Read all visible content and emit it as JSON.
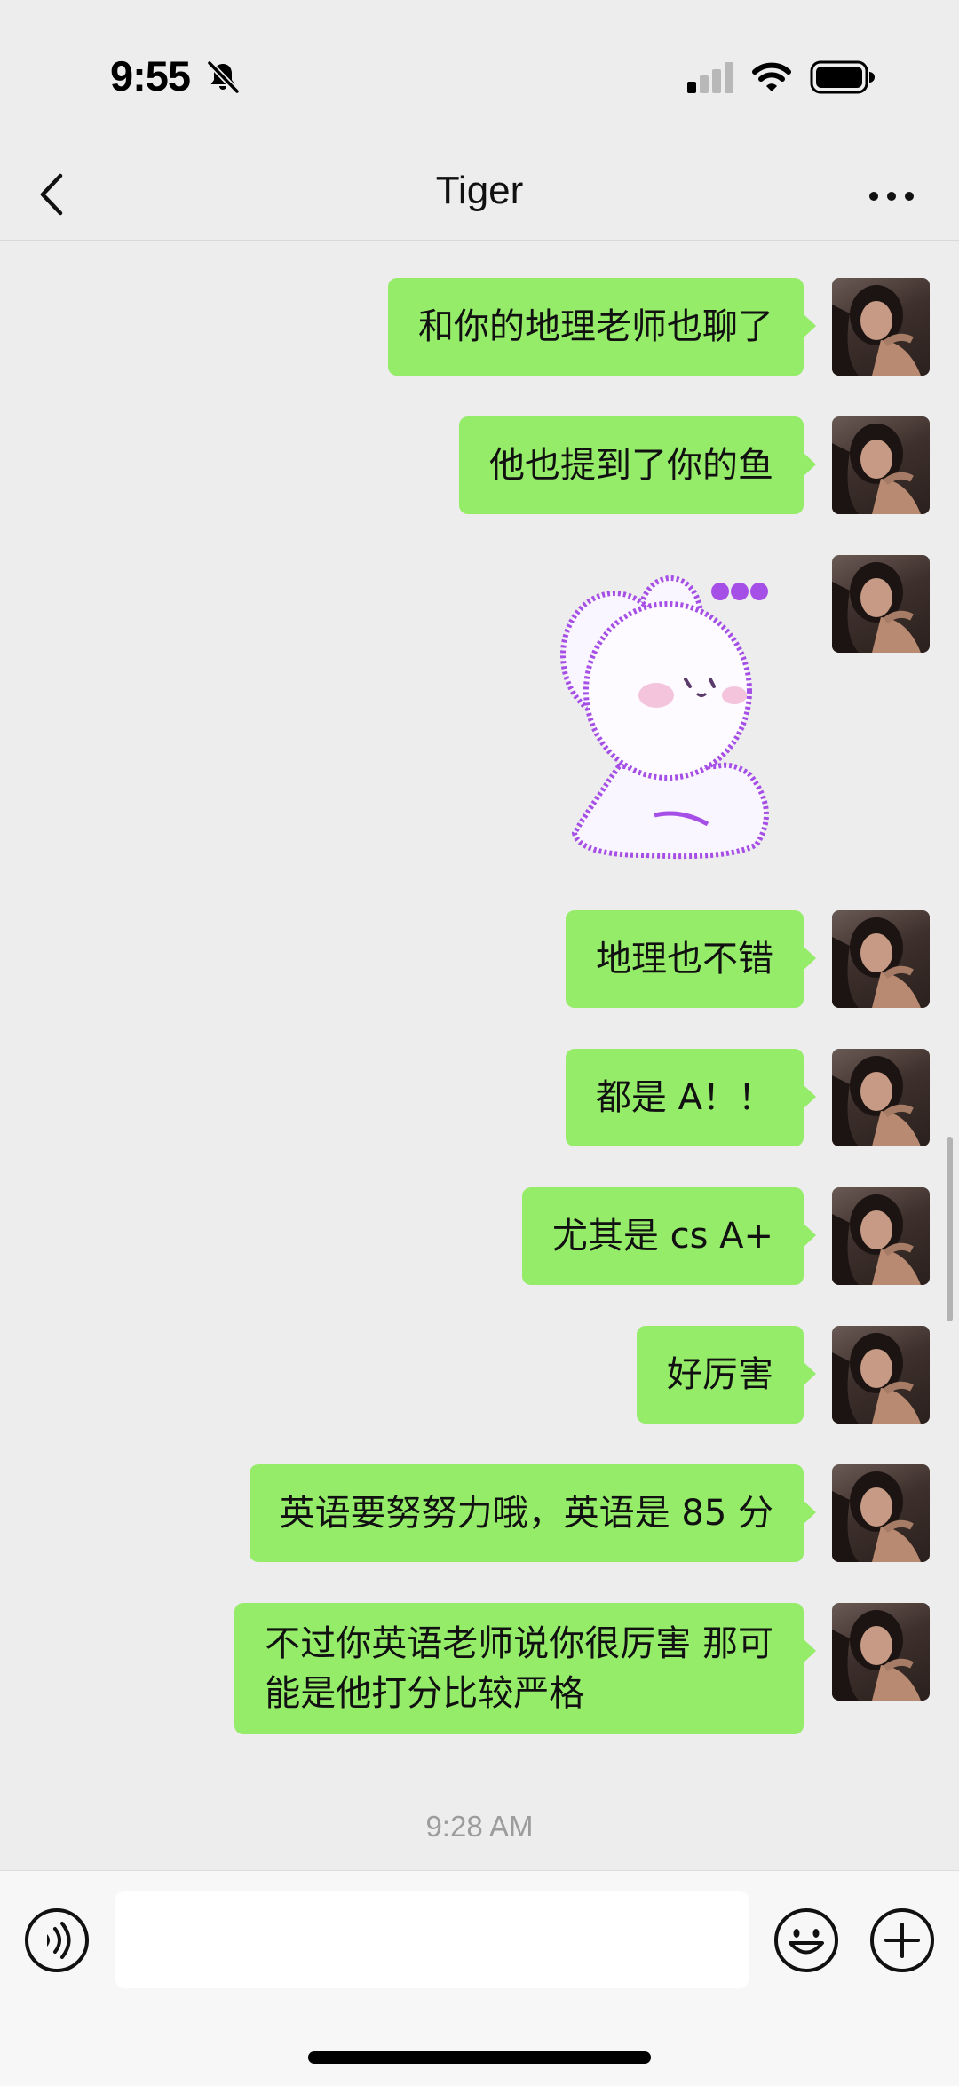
{
  "status_bar": {
    "time": "9:55"
  },
  "nav": {
    "title": "Tiger"
  },
  "messages": [
    {
      "type": "text",
      "text": "和你的地理老师也聊了"
    },
    {
      "type": "text",
      "text": "他也提到了你的鱼"
    },
    {
      "type": "sticker",
      "description": "white bunny sticker with ellipsis"
    },
    {
      "type": "text",
      "text": "地理也不错"
    },
    {
      "type": "text",
      "text": "都是 A！！"
    },
    {
      "type": "text",
      "text": "尤其是 cs A+"
    },
    {
      "type": "text",
      "text": "好厉害"
    },
    {
      "type": "text",
      "text": "英语要努努力哦，英语是 85 分"
    },
    {
      "type": "text",
      "lines": [
        "不过你英语老师说你很厉害 那可",
        "能是他打分比较严格"
      ]
    }
  ],
  "timestamp": "9:28 AM",
  "input": {
    "value": "",
    "placeholder": ""
  },
  "colors": {
    "bubble": "#95ec69",
    "background": "#ededed",
    "sticker_outline": "#a64fe6"
  }
}
